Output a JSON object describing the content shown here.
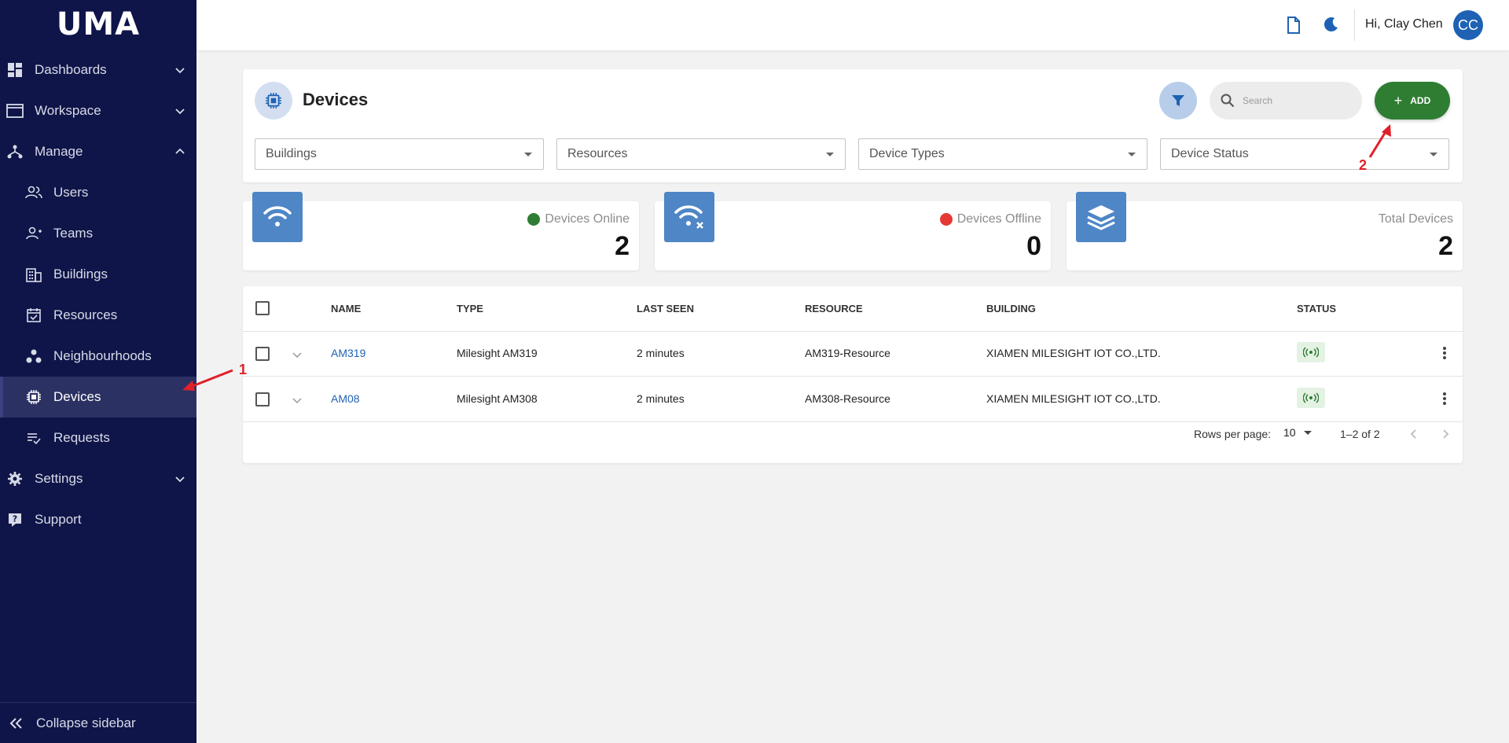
{
  "sidebar": {
    "logo": "UMA",
    "items": [
      {
        "label": "Dashboards"
      },
      {
        "label": "Workspace"
      },
      {
        "label": "Manage"
      },
      {
        "label": "Users"
      },
      {
        "label": "Teams"
      },
      {
        "label": "Buildings"
      },
      {
        "label": "Resources"
      },
      {
        "label": "Neighbourhoods"
      },
      {
        "label": "Devices"
      },
      {
        "label": "Requests"
      },
      {
        "label": "Settings"
      },
      {
        "label": "Support"
      }
    ],
    "collapse_label": "Collapse sidebar"
  },
  "header": {
    "greeting": "Hi, Clay Chen",
    "avatar_initials": "CC"
  },
  "page": {
    "title": "Devices",
    "search_placeholder": "Search",
    "add_label": "ADD",
    "filters": [
      "Buildings",
      "Resources",
      "Device Types",
      "Device Status"
    ]
  },
  "stats": {
    "online": {
      "label": "Devices Online",
      "value": "2",
      "color": "#2e7d32"
    },
    "offline": {
      "label": "Devices Offline",
      "value": "0",
      "color": "#e53935"
    },
    "total": {
      "label": "Total Devices",
      "value": "2"
    }
  },
  "table": {
    "columns": [
      "NAME",
      "TYPE",
      "LAST SEEN",
      "RESOURCE",
      "BUILDING",
      "STATUS"
    ],
    "rows": [
      {
        "name": "AM319",
        "type": "Milesight AM319",
        "last_seen": "2 minutes",
        "resource": "AM319-Resource",
        "building": "XIAMEN MILESIGHT IOT CO.,LTD.",
        "status_icon": "signal-icon"
      },
      {
        "name": "AM08",
        "type": "Milesight AM308",
        "last_seen": "2 minutes",
        "resource": "AM308-Resource",
        "building": "XIAMEN MILESIGHT IOT CO.,LTD.",
        "status_icon": "signal-icon"
      }
    ],
    "pagination": {
      "rows_per_page_label": "Rows per page:",
      "rows_per_page": "10",
      "range": "1–2 of 2"
    }
  },
  "annotations": {
    "a1": "1",
    "a2": "2"
  },
  "colors": {
    "sidebar_bg": "#0f1548",
    "primary": "#1f62b4",
    "add_green": "#2e7d32",
    "annotation_red": "#e0202a"
  }
}
